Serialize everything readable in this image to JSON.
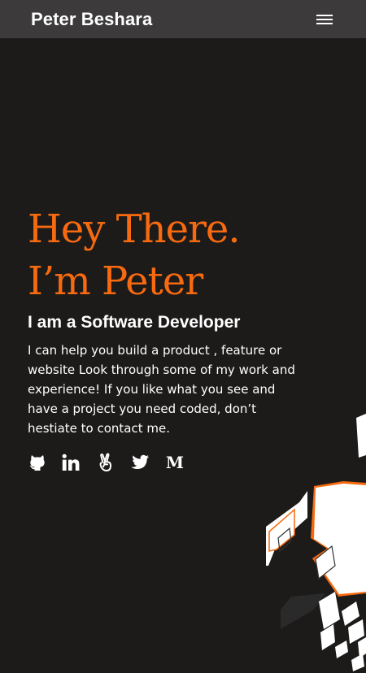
{
  "nav": {
    "brand": "Peter Beshara",
    "menu_icon": "hamburger-menu-icon"
  },
  "hero": {
    "heading_line1": "Hey There.",
    "heading_line2": "I’m Peter",
    "subtitle": "I am a Software Developer",
    "intro": "I can help you build a product , feature or website Look through some of my work and experience! If you like what you see and have a project you need coded, don’t hestiate to contact me."
  },
  "socials": [
    {
      "icon": "github-icon"
    },
    {
      "icon": "linkedin-icon"
    },
    {
      "icon": "angellist-icon"
    },
    {
      "icon": "twitter-icon"
    },
    {
      "icon": "medium-icon",
      "glyph": "M"
    }
  ],
  "colors": {
    "background": "#1d1b1a",
    "navbar": "#3c3a3a",
    "accent": "#f76a0f",
    "text": "#ffffff"
  }
}
